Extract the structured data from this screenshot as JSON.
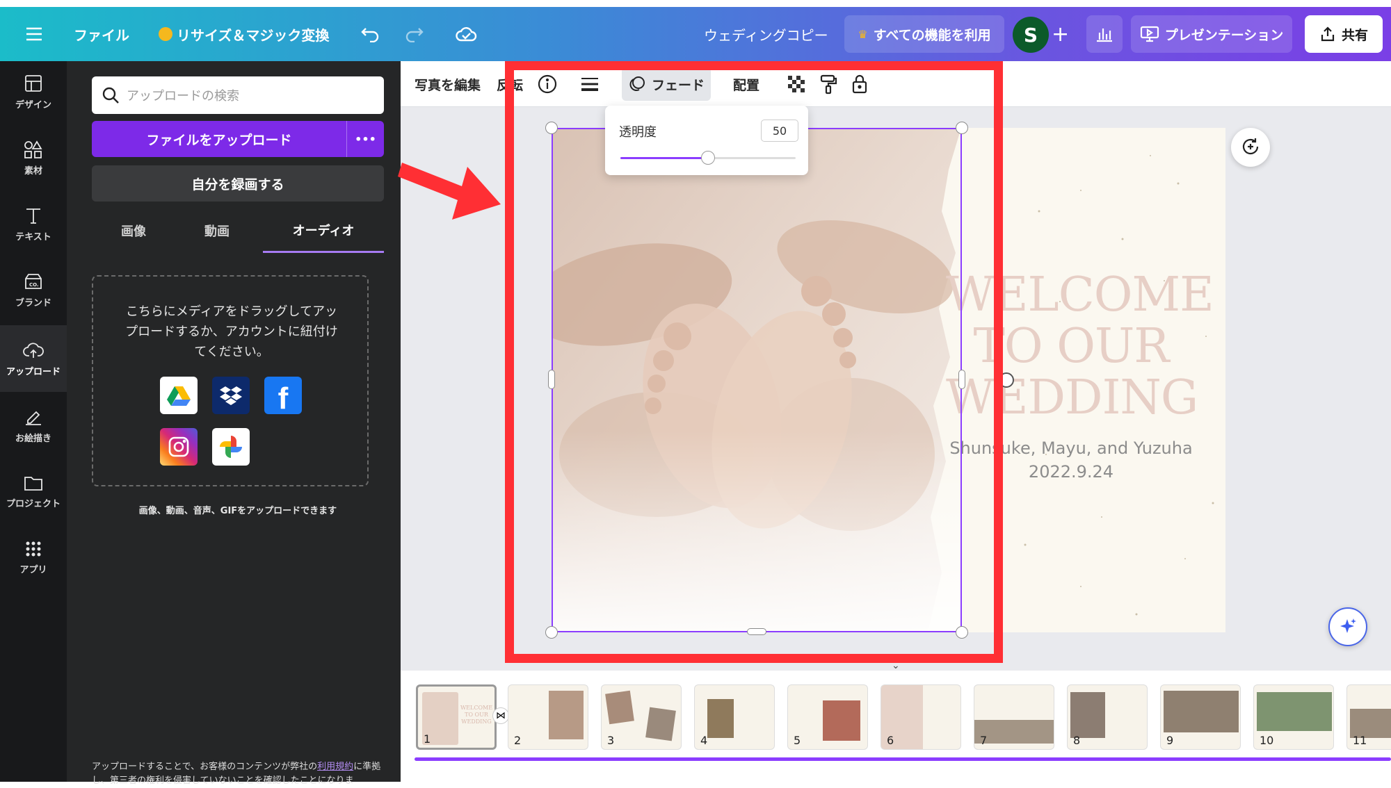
{
  "topbar": {
    "menu_icon": "hamburger-icon",
    "file": "ファイル",
    "resize": "リサイズ＆マジック変換",
    "doc_title": "ウェディングコピー",
    "pro_features": "すべての機能を利用",
    "avatar_letter": "S",
    "present": "プレゼンテーション",
    "share": "共有"
  },
  "rail": {
    "items": [
      {
        "label": "デザイン",
        "icon": "layout-icon"
      },
      {
        "label": "素材",
        "icon": "shapes-icon"
      },
      {
        "label": "テキスト",
        "icon": "text-icon"
      },
      {
        "label": "ブランド",
        "icon": "brand-icon"
      },
      {
        "label": "アップロード",
        "icon": "cloud-upload-icon"
      },
      {
        "label": "お絵描き",
        "icon": "draw-icon"
      },
      {
        "label": "プロジェクト",
        "icon": "folder-icon"
      },
      {
        "label": "アプリ",
        "icon": "apps-icon"
      }
    ]
  },
  "panel": {
    "search_placeholder": "アップロードの検索",
    "upload_button": "ファイルをアップロード",
    "more": "•••",
    "record_button": "自分を録画する",
    "tabs": [
      "画像",
      "動画",
      "オーディオ"
    ],
    "dropzone_text": "こちらにメディアをドラッグしてアップロードするか、アカウントに紐付けてください。",
    "note": "画像、動画、音声、GIFをアップロードできます",
    "legal_1": "アップロードすることで、お客様のコンテンツが弊社の",
    "legal_link": "利用規約",
    "legal_2": "に準拠し、第三者の権利を侵害していないことを確認したことになりま"
  },
  "context_toolbar": {
    "edit_photo": "写真を編集",
    "flip": "反転",
    "fade": "フェード",
    "position": "配置"
  },
  "transparency": {
    "label": "透明度",
    "value": "50",
    "fraction": 0.5
  },
  "canvas": {
    "welcome_lines": [
      "WELCOME",
      "TO OUR",
      "WEDDING"
    ],
    "names": "Shunsuke, Mayu, and Yuzuha",
    "date": "2022.9.24"
  },
  "thumbnails": [
    "1",
    "2",
    "3",
    "4",
    "5",
    "6",
    "7",
    "8",
    "9",
    "10",
    "11"
  ],
  "colors": {
    "accent": "#8b3dff",
    "highlight_box": "#ff2f34"
  }
}
